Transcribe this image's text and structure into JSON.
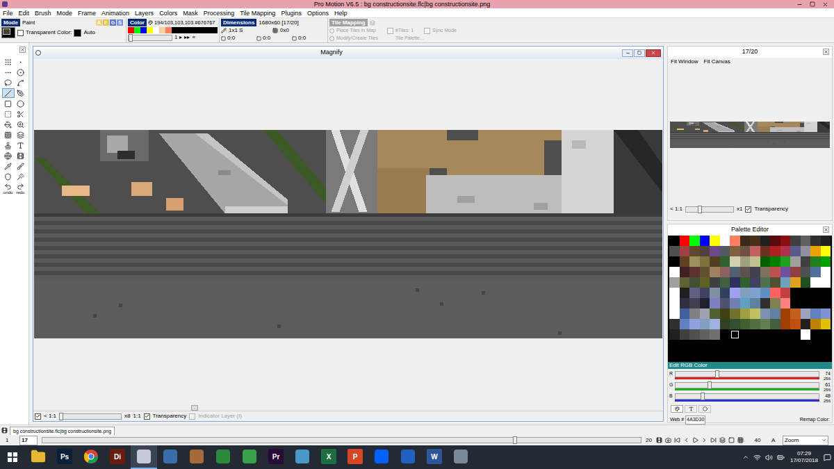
{
  "window": {
    "title": "Pro Motion V6.5 : bg constructionsite.flc|bg constructionsite.png"
  },
  "menu": [
    "File",
    "Edit",
    "Brush",
    "Mode",
    "Frame",
    "Animation",
    "Layers",
    "Colors",
    "Mask",
    "Processing",
    "Tile Mapping",
    "Plugins",
    "Options",
    "Help"
  ],
  "mode_panel": {
    "label": "Mode",
    "value": "Paint",
    "foreground": "#4a3d30",
    "background": "#000000",
    "transparent": {
      "label": "Transparent Color:",
      "checked": false
    },
    "transparent_color": "#000000",
    "auto": "Auto",
    "letters": [
      {
        "label": "A",
        "color": "#f3d27a"
      },
      {
        "label": "E",
        "color": "#f0c040"
      },
      {
        "label": "G",
        "color": "#5078e0"
      },
      {
        "label": "S",
        "color": "#8090e8"
      }
    ]
  },
  "color_panel": {
    "label": "Color",
    "value": "194/103,103,103 #676767",
    "swatches": [
      "#ff0000",
      "#00ff00",
      "#0000ff",
      "#ffff00",
      "#ffffff",
      "#f8d0a0",
      "#ff8060"
    ],
    "brush_size": "1",
    "size_level": 0.05,
    "arrows": [
      "▸",
      "▸▸",
      "«"
    ]
  },
  "dimensions_panel": {
    "label": "Dimensions",
    "size": "1680x60 [17/20]",
    "brush": "1x1 S",
    "offset": "0x0",
    "coords": [
      "0:0",
      "0:0",
      "0:0"
    ]
  },
  "tile_panel": {
    "label": "Tile Mapping",
    "disabled": true,
    "options": [
      {
        "label": "Place Tiles in Map",
        "selected": false
      },
      {
        "label": "Modify/Create Tiles",
        "selected": false
      }
    ],
    "tiles": {
      "label": "#Tiles: 1",
      "checked": false
    },
    "sync": {
      "label": "Sync Mode",
      "checked": false
    },
    "palette": "Tile Palette..."
  },
  "tools": [
    {
      "label": "",
      "selected": false
    },
    {
      "label": "",
      "selected": false
    },
    {
      "label": "",
      "selected": false
    },
    {
      "label": "",
      "selected": false
    },
    {
      "label": "",
      "selected": false
    },
    {
      "label": "",
      "selected": false
    },
    {
      "label": "",
      "selected": true
    },
    {
      "label": "",
      "selected": false
    },
    {
      "label": "",
      "selected": false
    },
    {
      "label": "",
      "selected": false
    },
    {
      "label": "",
      "selected": false
    },
    {
      "label": "",
      "selected": false
    },
    {
      "label": "",
      "selected": false
    },
    {
      "label": "",
      "selected": false
    },
    {
      "label": "",
      "selected": false
    },
    {
      "label": "",
      "selected": false
    },
    {
      "label": "",
      "selected": false
    },
    {
      "label": "",
      "selected": false
    },
    {
      "label": "",
      "selected": false
    },
    {
      "label": "",
      "selected": false
    },
    {
      "label": "",
      "selected": false
    },
    {
      "label": "",
      "selected": false
    },
    {
      "label": "",
      "selected": false
    },
    {
      "label": "",
      "selected": false
    },
    {
      "label": "undo",
      "selected": false
    },
    {
      "label": "redo",
      "selected": false
    }
  ],
  "magnify": {
    "title": "Magnify",
    "ratio": {
      "label": "< 1:1",
      "checked": true
    },
    "zoom_level": 0.02,
    "zoom": "x8",
    "scale": "1:1",
    "transparency": {
      "label": "Transparency",
      "checked": true
    },
    "indicator": {
      "label": "Indicator Layer (I)",
      "checked": false,
      "disabled": true
    },
    "scroll_level": 0.25
  },
  "preview": {
    "title": "17/20",
    "links": [
      "Fit Window",
      "Fit Canvas"
    ],
    "ratio": "< 1:1",
    "zoom_level": 0.3,
    "zoom": "x1",
    "transparency": {
      "label": "Transparency",
      "checked": true
    }
  },
  "palette_editor": {
    "title": "Palette Editor",
    "rows": [
      [
        {
          "color": "#000000",
          "selected": false
        },
        {
          "color": "#ff0000",
          "selected": false
        },
        {
          "color": "#00ff00",
          "selected": false
        },
        {
          "color": "#0000ff",
          "selected": false
        },
        {
          "color": "#ffff00",
          "selected": false
        },
        {
          "color": "#ffffff",
          "selected": false
        },
        {
          "color": "#ff8060",
          "selected": false
        },
        {
          "color": "#3a2a1a",
          "selected": false
        },
        {
          "color": "#4a3018",
          "selected": false
        },
        {
          "color": "#202020",
          "selected": false
        },
        {
          "color": "#5a0a0a",
          "selected": false
        },
        {
          "color": "#8a1010",
          "selected": false
        },
        {
          "color": "#404040",
          "selected": false
        },
        {
          "color": "#606060",
          "selected": false
        },
        {
          "color": "#303030",
          "selected": false
        },
        {
          "color": "#202020",
          "selected": false
        }
      ],
      [
        {
          "color": "#505050",
          "selected": false
        },
        {
          "color": "#a04040",
          "selected": false
        },
        {
          "color": "#604830",
          "selected": false
        },
        {
          "color": "#504040",
          "selected": false
        },
        {
          "color": "#6a4a8a",
          "selected": false
        },
        {
          "color": "#505a60",
          "selected": false
        },
        {
          "color": "#806040",
          "selected": false
        },
        {
          "color": "#705040",
          "selected": false
        },
        {
          "color": "#c06060",
          "selected": false
        },
        {
          "color": "#703020",
          "selected": false
        },
        {
          "color": "#b02020",
          "selected": false
        },
        {
          "color": "#b03050",
          "selected": false
        },
        {
          "color": "#5a5a8a",
          "selected": false
        },
        {
          "color": "#9090a0",
          "selected": false
        },
        {
          "color": "#f0a000",
          "selected": false
        },
        {
          "color": "#ffff00",
          "selected": false
        }
      ],
      [
        {
          "color": "#000000",
          "selected": false
        },
        {
          "color": "#604020",
          "selected": false
        },
        {
          "color": "#a09060",
          "selected": false
        },
        {
          "color": "#807040",
          "selected": false
        },
        {
          "color": "#504020",
          "selected": false
        },
        {
          "color": "#306030",
          "selected": false
        },
        {
          "color": "#d0d0b0",
          "selected": false
        },
        {
          "color": "#a0a080",
          "selected": false
        },
        {
          "color": "#c0c090",
          "selected": false
        },
        {
          "color": "#006000",
          "selected": false
        },
        {
          "color": "#008000",
          "selected": false
        },
        {
          "color": "#20a020",
          "selected": false
        },
        {
          "color": "#a0a0a0",
          "selected": false
        },
        {
          "color": "#404040",
          "selected": false
        },
        {
          "color": "#208020",
          "selected": false
        },
        {
          "color": "#00a000",
          "selected": false
        }
      ],
      [
        {
          "color": "#ffffff",
          "selected": false
        },
        {
          "color": "#402020",
          "selected": false
        },
        {
          "color": "#603030",
          "selected": false
        },
        {
          "color": "#605030",
          "selected": false
        },
        {
          "color": "#a08060",
          "selected": false
        },
        {
          "color": "#906060",
          "selected": false
        },
        {
          "color": "#506070",
          "selected": false
        },
        {
          "color": "#605050",
          "selected": false
        },
        {
          "color": "#404050",
          "selected": false
        },
        {
          "color": "#807060",
          "selected": false
        },
        {
          "color": "#c05050",
          "selected": false
        },
        {
          "color": "#7050a0",
          "selected": false
        },
        {
          "color": "#904040",
          "selected": false
        },
        {
          "color": "#505050",
          "selected": false
        },
        {
          "color": "#5070a0",
          "selected": false
        },
        {
          "color": "#ffffff",
          "selected": false
        }
      ],
      [
        {
          "color": "#a0a0a0",
          "selected": false
        },
        {
          "color": "#606030",
          "selected": false
        },
        {
          "color": "#405030",
          "selected": false
        },
        {
          "color": "#606020",
          "selected": false
        },
        {
          "color": "#404040",
          "selected": false
        },
        {
          "color": "#406040",
          "selected": false
        },
        {
          "color": "#303060",
          "selected": false
        },
        {
          "color": "#306030",
          "selected": false
        },
        {
          "color": "#404060",
          "selected": false
        },
        {
          "color": "#507050",
          "selected": false
        },
        {
          "color": "#505030",
          "selected": false
        },
        {
          "color": "#70a0c0",
          "selected": false
        },
        {
          "color": "#e0a020",
          "selected": false
        },
        {
          "color": "#205020",
          "selected": false
        },
        {
          "color": "#ffffff",
          "selected": false
        },
        {
          "color": "#ffffff",
          "selected": false
        }
      ],
      [
        {
          "color": "#ffffff",
          "selected": false
        },
        {
          "color": "#202020",
          "selected": false
        },
        {
          "color": "#606080",
          "selected": false
        },
        {
          "color": "#404060",
          "selected": false
        },
        {
          "color": "#8090a0",
          "selected": false
        },
        {
          "color": "#304060",
          "selected": false
        },
        {
          "color": "#a0a0f0",
          "selected": false
        },
        {
          "color": "#80a0c0",
          "selected": false
        },
        {
          "color": "#80a0d0",
          "selected": false
        },
        {
          "color": "#6090c0",
          "selected": false
        },
        {
          "color": "#ff6060",
          "selected": false
        },
        {
          "color": "#c04040",
          "selected": false
        },
        {
          "color": "#000000",
          "selected": false
        },
        {
          "color": "#000000",
          "selected": false
        },
        {
          "color": "#000000",
          "selected": false
        },
        {
          "color": "#000000",
          "selected": false
        }
      ],
      [
        {
          "color": "#ffffff",
          "selected": false
        },
        {
          "color": "#303040",
          "selected": false
        },
        {
          "color": "#404050",
          "selected": false
        },
        {
          "color": "#202030",
          "selected": false
        },
        {
          "color": "#8080c0",
          "selected": false
        },
        {
          "color": "#505070",
          "selected": false
        },
        {
          "color": "#7080b0",
          "selected": false
        },
        {
          "color": "#60a0c0",
          "selected": false
        },
        {
          "color": "#6080a0",
          "selected": false
        },
        {
          "color": "#303030",
          "selected": false
        },
        {
          "color": "#808050",
          "selected": false
        },
        {
          "color": "#ff8080",
          "selected": false
        },
        {
          "color": "#000000",
          "selected": false
        },
        {
          "color": "#000000",
          "selected": false
        },
        {
          "color": "#000000",
          "selected": false
        },
        {
          "color": "#000000",
          "selected": false
        }
      ],
      [
        {
          "color": "#ffffff",
          "selected": false
        },
        {
          "color": "#4060a0",
          "selected": false
        },
        {
          "color": "#808080",
          "selected": false
        },
        {
          "color": "#a0a0b0",
          "selected": false
        },
        {
          "color": "#506030",
          "selected": false
        },
        {
          "color": "#404010",
          "selected": false
        },
        {
          "color": "#707030",
          "selected": false
        },
        {
          "color": "#a0a040",
          "selected": false
        },
        {
          "color": "#c0c060",
          "selected": false
        },
        {
          "color": "#8090b0",
          "selected": false
        },
        {
          "color": "#6080a0",
          "selected": false
        },
        {
          "color": "#a04000",
          "selected": false
        },
        {
          "color": "#c06020",
          "selected": false
        },
        {
          "color": "#a0a0c0",
          "selected": false
        },
        {
          "color": "#6080c0",
          "selected": false
        },
        {
          "color": "#8090d0",
          "selected": false
        }
      ],
      [
        {
          "color": "#303030",
          "selected": false
        },
        {
          "color": "#6080c0",
          "selected": false
        },
        {
          "color": "#90a0e0",
          "selected": false
        },
        {
          "color": "#80a0c0",
          "selected": false
        },
        {
          "color": "#a0b0e0",
          "selected": false
        },
        {
          "color": "#304020",
          "selected": false
        },
        {
          "color": "#305030",
          "selected": false
        },
        {
          "color": "#406030",
          "selected": false
        },
        {
          "color": "#507040",
          "selected": false
        },
        {
          "color": "#608050",
          "selected": false
        },
        {
          "color": "#406040",
          "selected": false
        },
        {
          "color": "#a04000",
          "selected": false
        },
        {
          "color": "#c05010",
          "selected": false
        },
        {
          "color": "#202020",
          "selected": false
        },
        {
          "color": "#c08000",
          "selected": false
        },
        {
          "color": "#e0c000",
          "selected": false
        }
      ],
      [
        {
          "color": "#202020",
          "selected": false
        },
        {
          "color": "#404040",
          "selected": false
        },
        {
          "color": "#505050",
          "selected": false
        },
        {
          "color": "#606060",
          "selected": false
        },
        {
          "color": "#707070",
          "selected": false
        },
        {
          "color": "#000000",
          "selected": false
        },
        {
          "color": "#000000",
          "selected": true
        },
        {
          "color": "#000000",
          "selected": false
        },
        {
          "color": "#000000",
          "selected": false
        },
        {
          "color": "#000000",
          "selected": false
        },
        {
          "color": "#000000",
          "selected": false
        },
        {
          "color": "#000000",
          "selected": false
        },
        {
          "color": "#000000",
          "selected": false
        },
        {
          "color": "#ffffff",
          "selected": false
        },
        {
          "color": "#000000",
          "selected": false
        },
        {
          "color": "#000000",
          "selected": false
        }
      ]
    ],
    "edit_title": "Edit RGB Color",
    "channels": [
      {
        "name": "R",
        "value": "74",
        "max": "256",
        "level": 0.289,
        "color": "#e02020"
      },
      {
        "name": "G",
        "value": "61",
        "max": "256",
        "level": 0.238,
        "color": "#20b020"
      },
      {
        "name": "B",
        "value": "48",
        "max": "256",
        "level": 0.188,
        "color": "#3030d0"
      }
    ],
    "web_label": "Web #",
    "web_value": "4A3D30",
    "remap": "Remap Color:"
  },
  "document_tab": {
    "label": "bg constructionsite.flc|bg constructionsite.png"
  },
  "frames": {
    "first": "1",
    "current": "17",
    "last": "20",
    "level": 0.79,
    "speed": "40",
    "mode": "A",
    "zoom": "Zoom"
  },
  "taskbar": {
    "apps": [
      {
        "kind": "folder",
        "label": "",
        "color": "#e8b830",
        "active": false
      },
      {
        "kind": "tile",
        "label": "Ps",
        "color": "#0a1f3a",
        "active": false
      },
      {
        "kind": "chrome",
        "label": "",
        "color": "#db4437",
        "active": false
      },
      {
        "kind": "tile",
        "label": "Di",
        "color": "#6a1c0c",
        "active": false
      },
      {
        "kind": "app",
        "label": "",
        "color": "#c8c8d8",
        "active": true
      },
      {
        "kind": "app",
        "label": "",
        "color": "#3a6ea8",
        "active": false
      },
      {
        "kind": "app",
        "label": "",
        "color": "#a86a3a",
        "active": false
      },
      {
        "kind": "app",
        "label": "",
        "color": "#2a8a3a",
        "active": false
      },
      {
        "kind": "app",
        "label": "",
        "color": "#3aa04a",
        "active": false
      },
      {
        "kind": "tile",
        "label": "Pr",
        "color": "#2a0a3a",
        "active": false
      },
      {
        "kind": "app",
        "label": "",
        "color": "#4a9ac8",
        "active": false
      },
      {
        "kind": "tile",
        "label": "X",
        "color": "#1d6f42",
        "active": false
      },
      {
        "kind": "tile",
        "label": "P",
        "color": "#d24726",
        "active": false
      },
      {
        "kind": "app",
        "label": "",
        "color": "#0061fe",
        "active": false
      },
      {
        "kind": "app",
        "label": "",
        "color": "#2060c0",
        "active": false
      },
      {
        "kind": "tile",
        "label": "W",
        "color": "#2b579a",
        "active": false
      },
      {
        "kind": "app",
        "label": "",
        "color": "#7a8a9a",
        "active": false
      }
    ],
    "time": "07:29",
    "date": "17/07/2018"
  }
}
